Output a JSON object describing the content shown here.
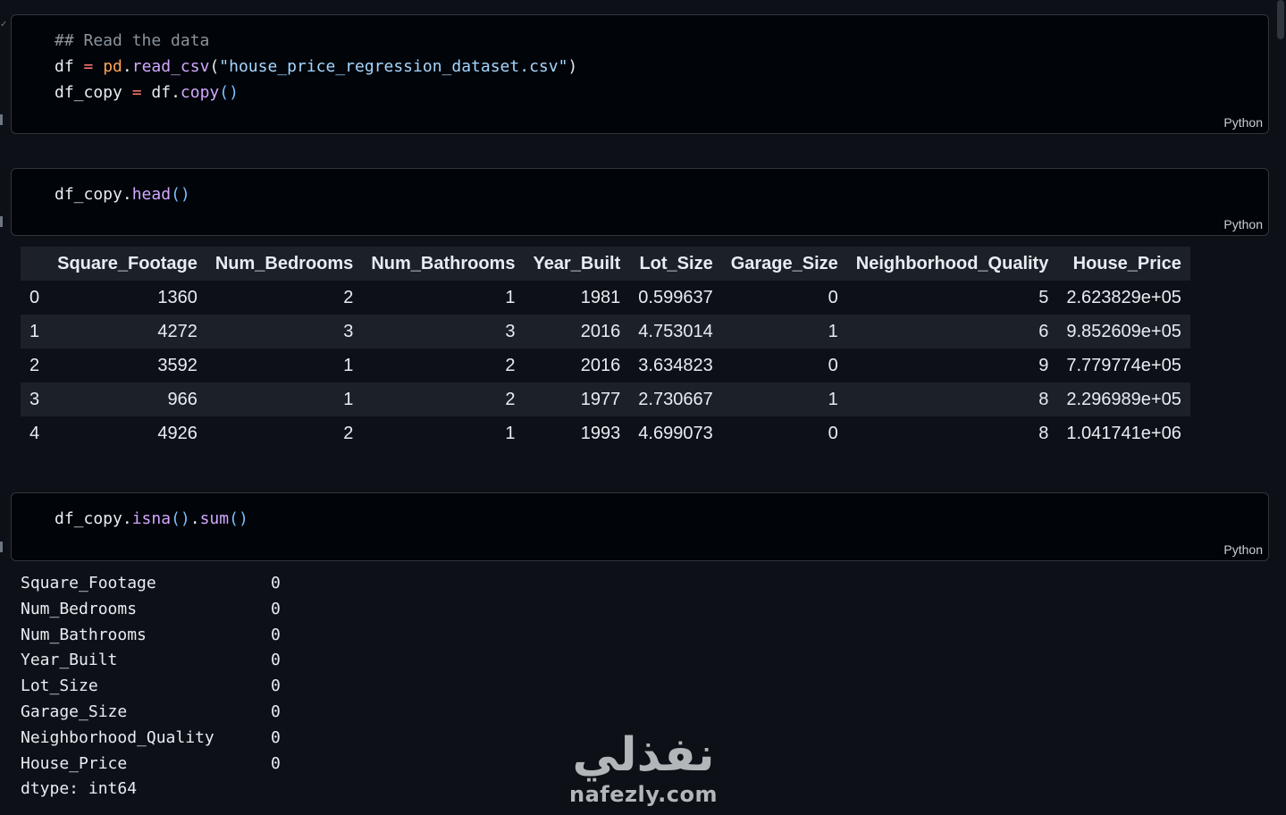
{
  "cells": [
    {
      "lang": "Python",
      "lines": [
        [
          {
            "t": "## Read the data",
            "c": "c-comment"
          }
        ],
        [
          {
            "t": "df",
            "c": "c-var"
          },
          {
            "t": " = ",
            "c": "c-op"
          },
          {
            "t": "pd",
            "c": "c-mod"
          },
          {
            "t": ".",
            "c": "c-var"
          },
          {
            "t": "read_csv",
            "c": "c-fn"
          },
          {
            "t": "(",
            "c": "c-var"
          },
          {
            "t": "\"house_price_regression_dataset.csv\"",
            "c": "c-str"
          },
          {
            "t": ")",
            "c": "c-var"
          }
        ],
        [
          {
            "t": "df_copy",
            "c": "c-var"
          },
          {
            "t": " = ",
            "c": "c-op"
          },
          {
            "t": "df",
            "c": "c-var"
          },
          {
            "t": ".",
            "c": "c-var"
          },
          {
            "t": "copy",
            "c": "c-fn"
          },
          {
            "t": "()",
            "c": "c-paren"
          }
        ]
      ]
    },
    {
      "lang": "Python",
      "lines": [
        [
          {
            "t": "df_copy",
            "c": "c-var"
          },
          {
            "t": ".",
            "c": "c-var"
          },
          {
            "t": "head",
            "c": "c-fn"
          },
          {
            "t": "()",
            "c": "c-paren"
          }
        ]
      ]
    },
    {
      "lang": "Python",
      "lines": [
        [
          {
            "t": "df_copy",
            "c": "c-var"
          },
          {
            "t": ".",
            "c": "c-var"
          },
          {
            "t": "isna",
            "c": "c-fn"
          },
          {
            "t": "()",
            "c": "c-paren"
          },
          {
            "t": ".",
            "c": "c-var"
          },
          {
            "t": "sum",
            "c": "c-fn"
          },
          {
            "t": "()",
            "c": "c-paren"
          }
        ]
      ]
    }
  ],
  "dataframe": {
    "columns": [
      "",
      "Square_Footage",
      "Num_Bedrooms",
      "Num_Bathrooms",
      "Year_Built",
      "Lot_Size",
      "Garage_Size",
      "Neighborhood_Quality",
      "House_Price"
    ],
    "rows": [
      [
        "0",
        "1360",
        "2",
        "1",
        "1981",
        "0.599637",
        "0",
        "5",
        "2.623829e+05"
      ],
      [
        "1",
        "4272",
        "3",
        "3",
        "2016",
        "4.753014",
        "1",
        "6",
        "9.852609e+05"
      ],
      [
        "2",
        "3592",
        "1",
        "2",
        "2016",
        "3.634823",
        "0",
        "9",
        "7.779774e+05"
      ],
      [
        "3",
        "966",
        "1",
        "2",
        "1977",
        "2.730667",
        "1",
        "8",
        "2.296989e+05"
      ],
      [
        "4",
        "4926",
        "2",
        "1",
        "1993",
        "4.699073",
        "0",
        "8",
        "1.041741e+06"
      ]
    ]
  },
  "isna_output": {
    "rows": [
      [
        "Square_Footage",
        "0"
      ],
      [
        "Num_Bedrooms",
        "0"
      ],
      [
        "Num_Bathrooms",
        "0"
      ],
      [
        "Year_Built",
        "0"
      ],
      [
        "Lot_Size",
        "0"
      ],
      [
        "Garage_Size",
        "0"
      ],
      [
        "Neighborhood_Quality",
        "0"
      ],
      [
        "House_Price",
        "0"
      ]
    ],
    "dtype_line": "dtype: int64"
  },
  "watermark": {
    "arabic": "نفذلي",
    "domain": "nafezly.com"
  }
}
